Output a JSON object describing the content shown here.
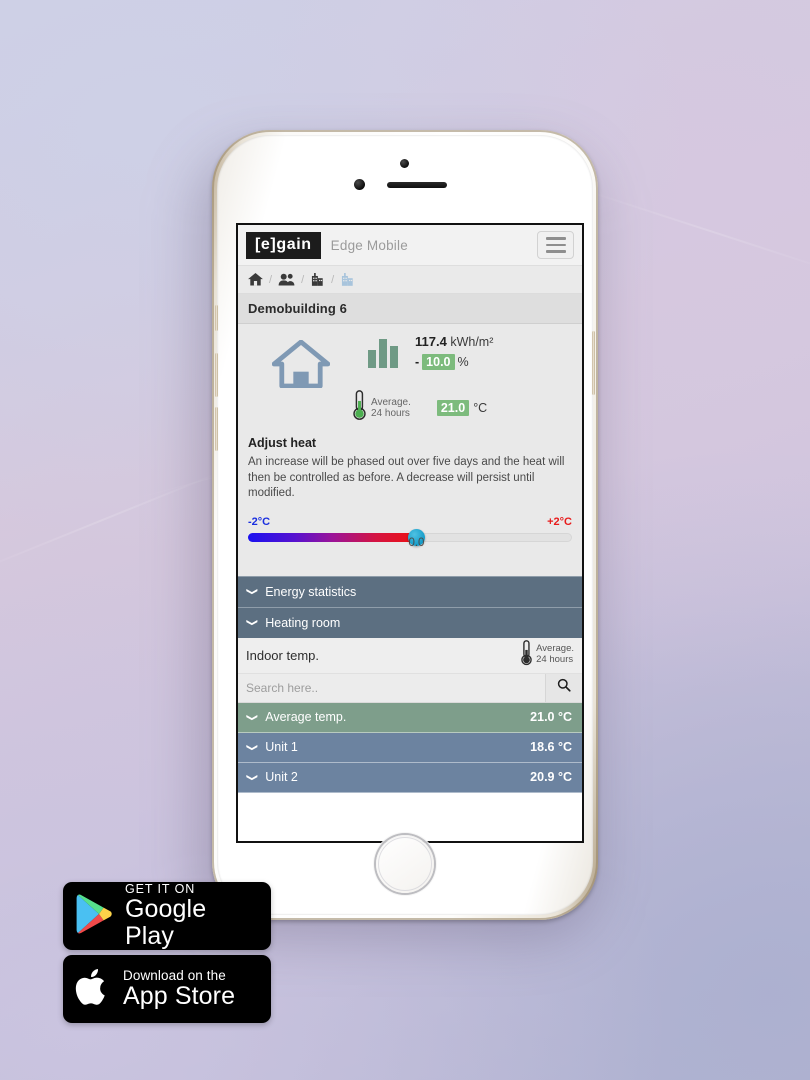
{
  "app": {
    "logo_text": "[e]gain",
    "title": "Edge Mobile",
    "menu_icon": "hamburger-menu-icon"
  },
  "breadcrumb": {
    "items": [
      {
        "icon": "home-icon",
        "state": "inactive"
      },
      {
        "icon": "users-group-icon",
        "state": "inactive"
      },
      {
        "icon": "building-icon",
        "state": "inactive"
      },
      {
        "icon": "building-icon",
        "state": "active"
      }
    ],
    "separator": "/"
  },
  "page": {
    "title": "Demobuilding 6"
  },
  "summary": {
    "house_icon": "house-icon",
    "bars_icon": "bar-chart-icon",
    "energy_value": "117.4",
    "energy_unit": "kWh/m²",
    "change_sign": "-",
    "change_value": "10.0",
    "change_unit": "%",
    "thermo_icon": "thermometer-icon",
    "avg_label_line1": "Average.",
    "avg_label_line2": "24 hours",
    "temp_value": "21.0",
    "temp_unit": "°C"
  },
  "adjust": {
    "title": "Adjust heat",
    "description": "An increase will be phased out over five days and the heat will then be controlled as before. A decrease will persist until modified.",
    "min_label": "-2°C",
    "max_label": "+2°C",
    "value": "0.0",
    "fill_percent": 52,
    "min_color": "#1a2fe0",
    "max_color": "#e81b1b",
    "handle_color": "#149cc9"
  },
  "accordions": [
    {
      "label": "Energy statistics",
      "chevron": "chevron-down-icon"
    },
    {
      "label": "Heating room",
      "chevron": "chevron-down-icon"
    }
  ],
  "indoor": {
    "title": "Indoor temp.",
    "thermo_icon": "thermometer-icon",
    "avg_label_line1": "Average.",
    "avg_label_line2": "24 hours"
  },
  "search": {
    "placeholder": "Search here..",
    "value": "",
    "icon": "search-icon"
  },
  "temp_rows": [
    {
      "label": "Average temp.",
      "value": "21.0 °C",
      "type": "avg",
      "chevron": "chevron-down-icon",
      "color": "#7e9e8b"
    },
    {
      "label": "Unit 1",
      "value": "18.6 °C",
      "type": "unit",
      "chevron": "chevron-down-icon",
      "color": "#6c83a0"
    },
    {
      "label": "Unit 2",
      "value": "20.9 °C",
      "type": "unit",
      "chevron": "chevron-down-icon",
      "color": "#6c83a0"
    }
  ],
  "badges": {
    "google": {
      "small": "GET IT ON",
      "big": "Google Play",
      "icon": "google-play-icon"
    },
    "apple": {
      "small": "Download on the",
      "big": "App Store",
      "icon": "apple-logo-icon"
    }
  }
}
